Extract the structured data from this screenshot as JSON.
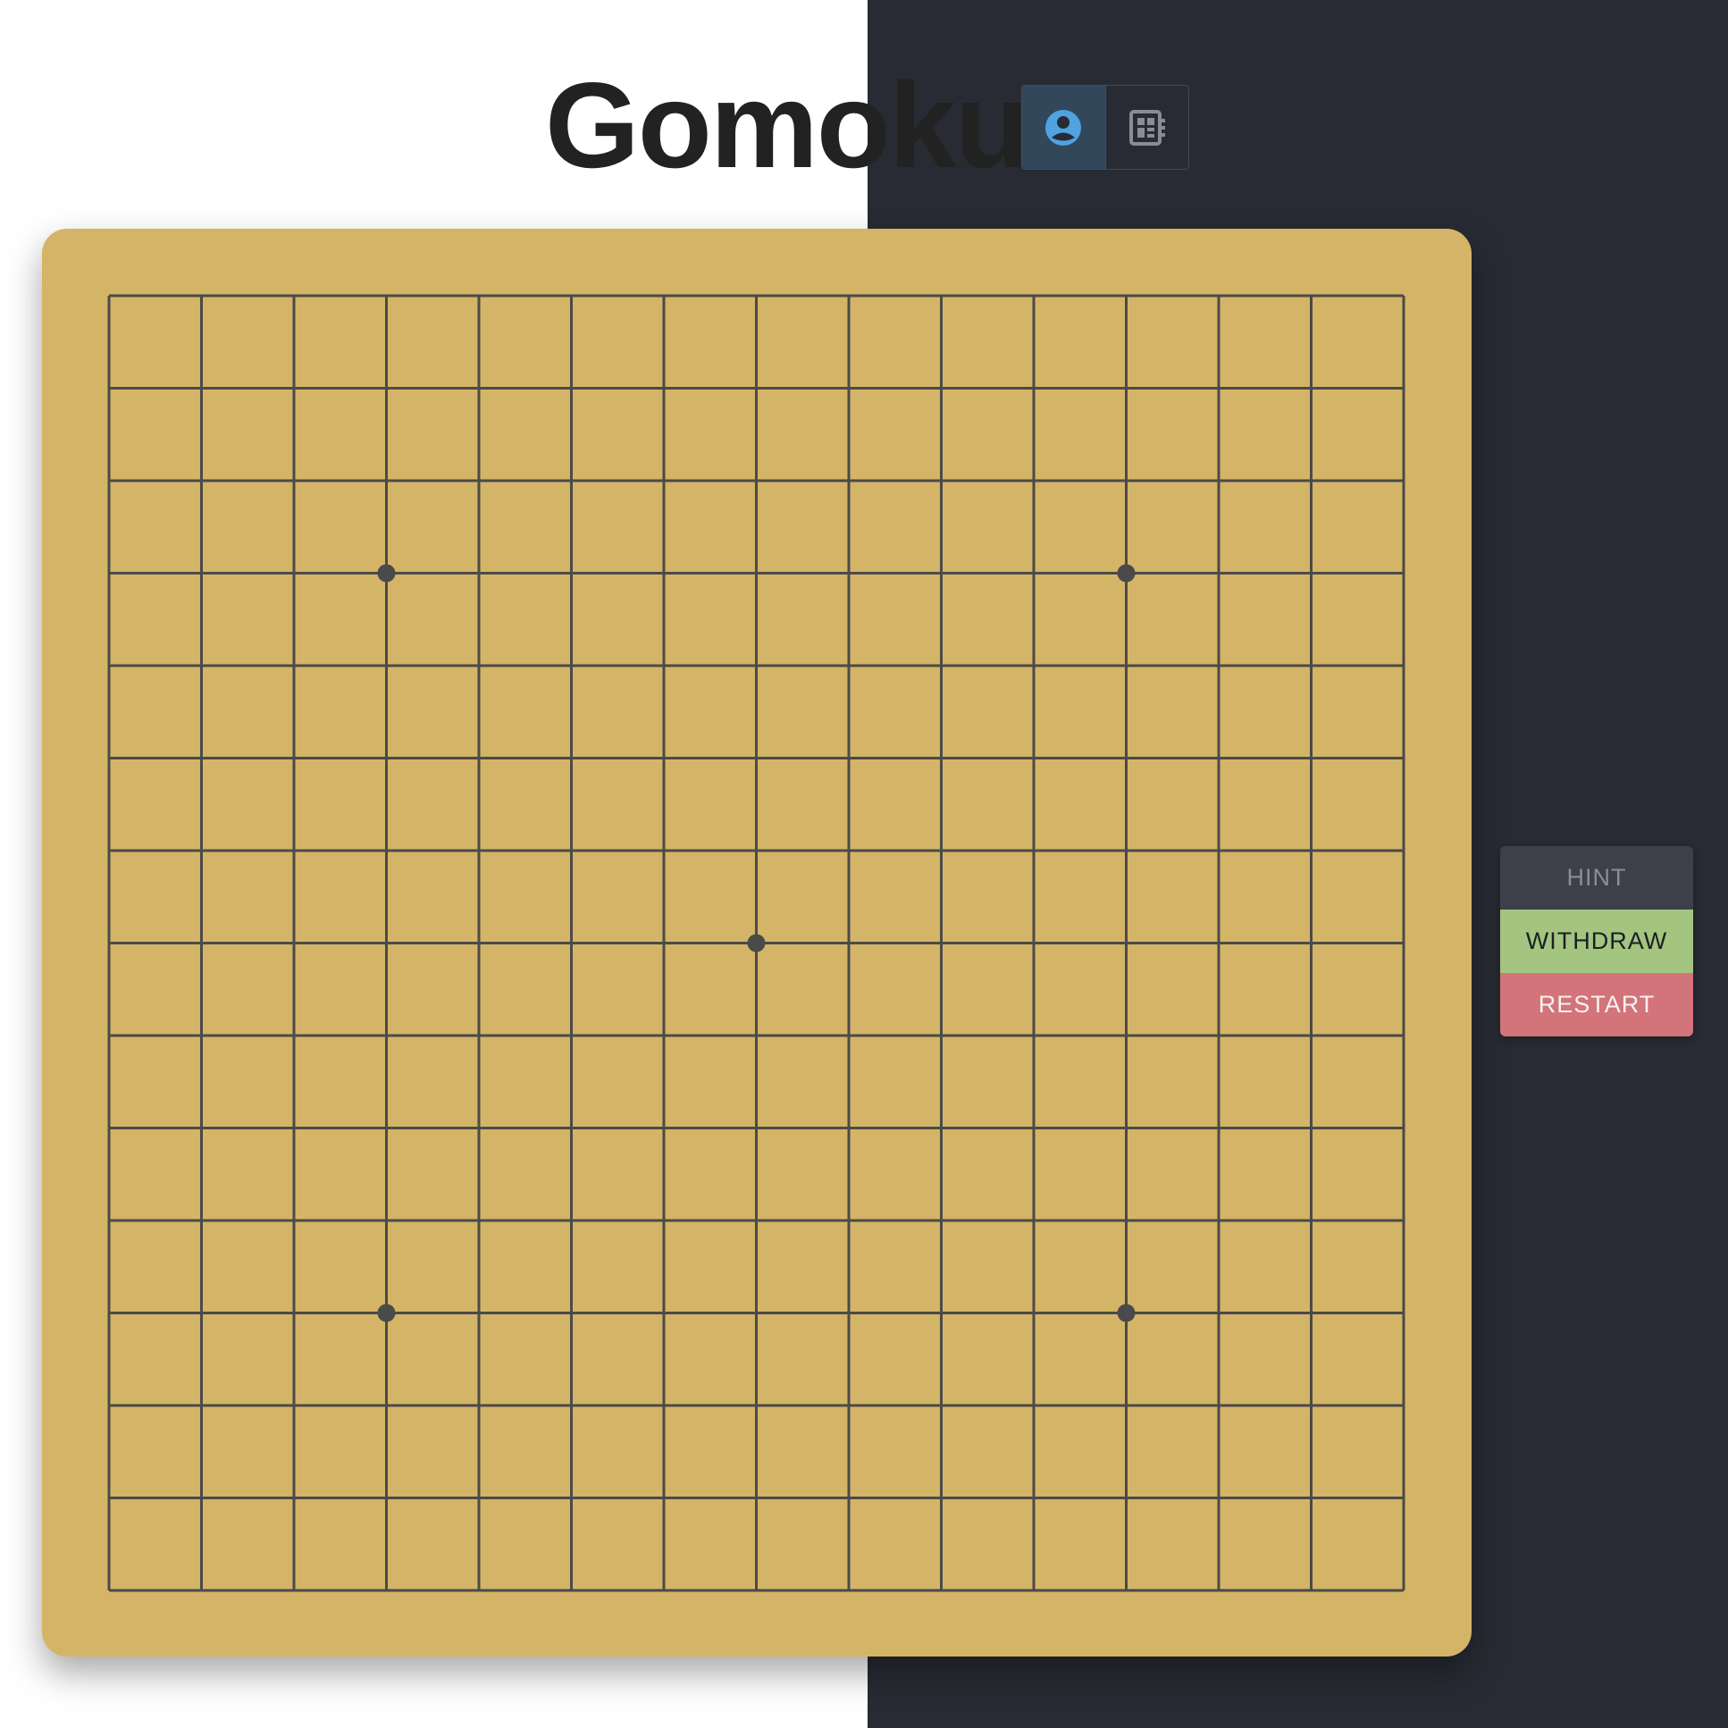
{
  "header": {
    "title": "Gomoku"
  },
  "mode_toggle": {
    "options": [
      {
        "icon": "person-icon",
        "active": true,
        "color": "#4fa3e0"
      },
      {
        "icon": "board-icon",
        "active": false,
        "color": "#8a8d95"
      }
    ]
  },
  "board": {
    "size": 15,
    "background": "#d4b466",
    "line_color": "#4a4a4a",
    "star_points": [
      [
        3,
        3
      ],
      [
        3,
        11
      ],
      [
        7,
        7
      ],
      [
        11,
        3
      ],
      [
        11,
        11
      ]
    ],
    "stones": []
  },
  "actions": {
    "hint_label": "HINT",
    "withdraw_label": "WITHDRAW",
    "restart_label": "RESTART"
  },
  "colors": {
    "left_background": "#ffffff",
    "right_background": "#282b33",
    "hint": "#3d404b",
    "withdraw": "#a3c57f",
    "restart": "#d3737a"
  }
}
